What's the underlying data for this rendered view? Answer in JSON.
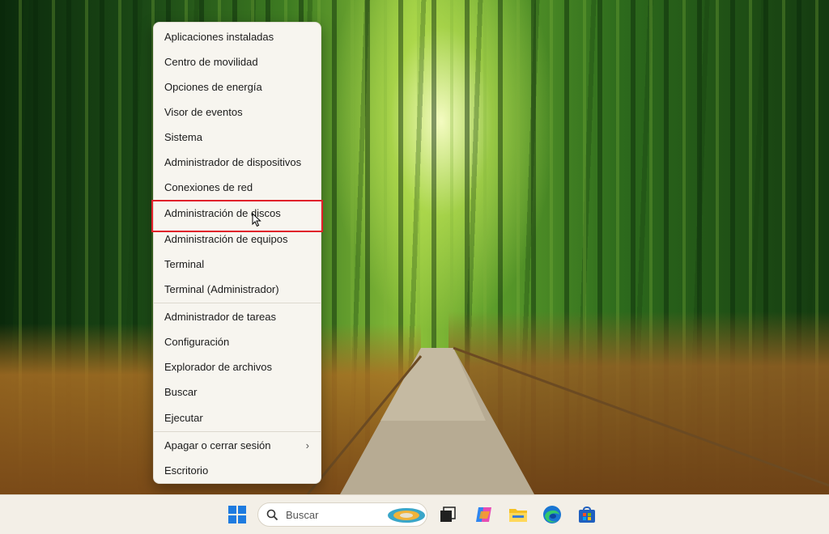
{
  "context_menu": {
    "items": [
      {
        "label": "Aplicaciones instaladas"
      },
      {
        "label": "Centro de movilidad"
      },
      {
        "label": "Opciones de energía"
      },
      {
        "label": "Visor de eventos"
      },
      {
        "label": "Sistema"
      },
      {
        "label": "Administrador de dispositivos"
      },
      {
        "label": "Conexiones de red"
      },
      {
        "label": "Administración de discos"
      },
      {
        "label": "Administración de equipos"
      },
      {
        "label": "Terminal"
      },
      {
        "label": "Terminal (Administrador)"
      },
      {
        "label": "Administrador de tareas"
      },
      {
        "label": "Configuración"
      },
      {
        "label": "Explorador de archivos"
      },
      {
        "label": "Buscar"
      },
      {
        "label": "Ejecutar"
      },
      {
        "label": "Apagar o cerrar sesión"
      },
      {
        "label": "Escritorio"
      }
    ],
    "highlighted_item": "Administración de discos",
    "submenu_arrow": "›"
  },
  "taskbar": {
    "search_placeholder": "Buscar",
    "icons": [
      "windows-start-icon",
      "search-icon",
      "task-view-icon",
      "copilot-icon",
      "file-explorer-icon",
      "edge-browser-icon",
      "microsoft-store-icon"
    ]
  },
  "colors": {
    "highlight_border": "#e0202a",
    "menu_background": "#f7f5ef",
    "taskbar_background": "#f3efe7",
    "windows_blue": "#1e7be0"
  }
}
